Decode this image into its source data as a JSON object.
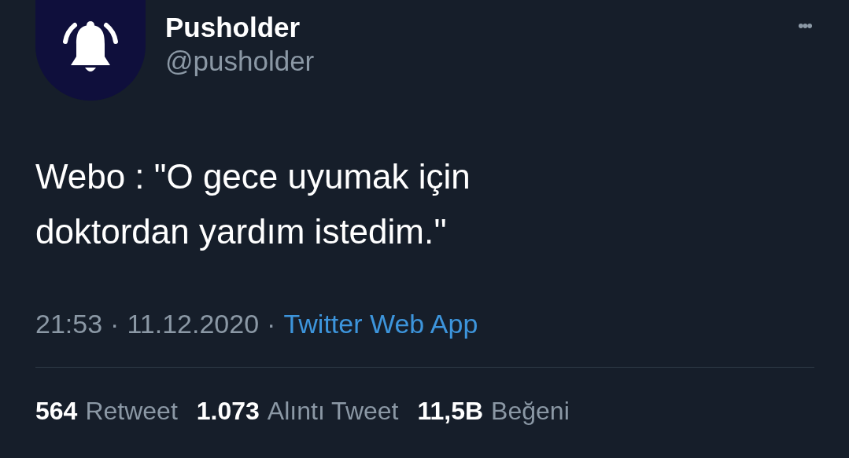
{
  "author": {
    "name": "Pusholder",
    "handle": "@pusholder"
  },
  "more_button": "•••",
  "tweet_text": [
    "Webo : \"O gece uyumak için",
    "doktordan yardım istedim.''"
  ],
  "meta": {
    "time": "21:53",
    "separator": "·",
    "date": "11.12.2020",
    "source": "Twitter Web App"
  },
  "stats": [
    {
      "count": "564",
      "label": "Retweet"
    },
    {
      "count": "1.073",
      "label": "Alıntı Tweet"
    },
    {
      "count": "11,5B",
      "label": "Beğeni"
    }
  ]
}
